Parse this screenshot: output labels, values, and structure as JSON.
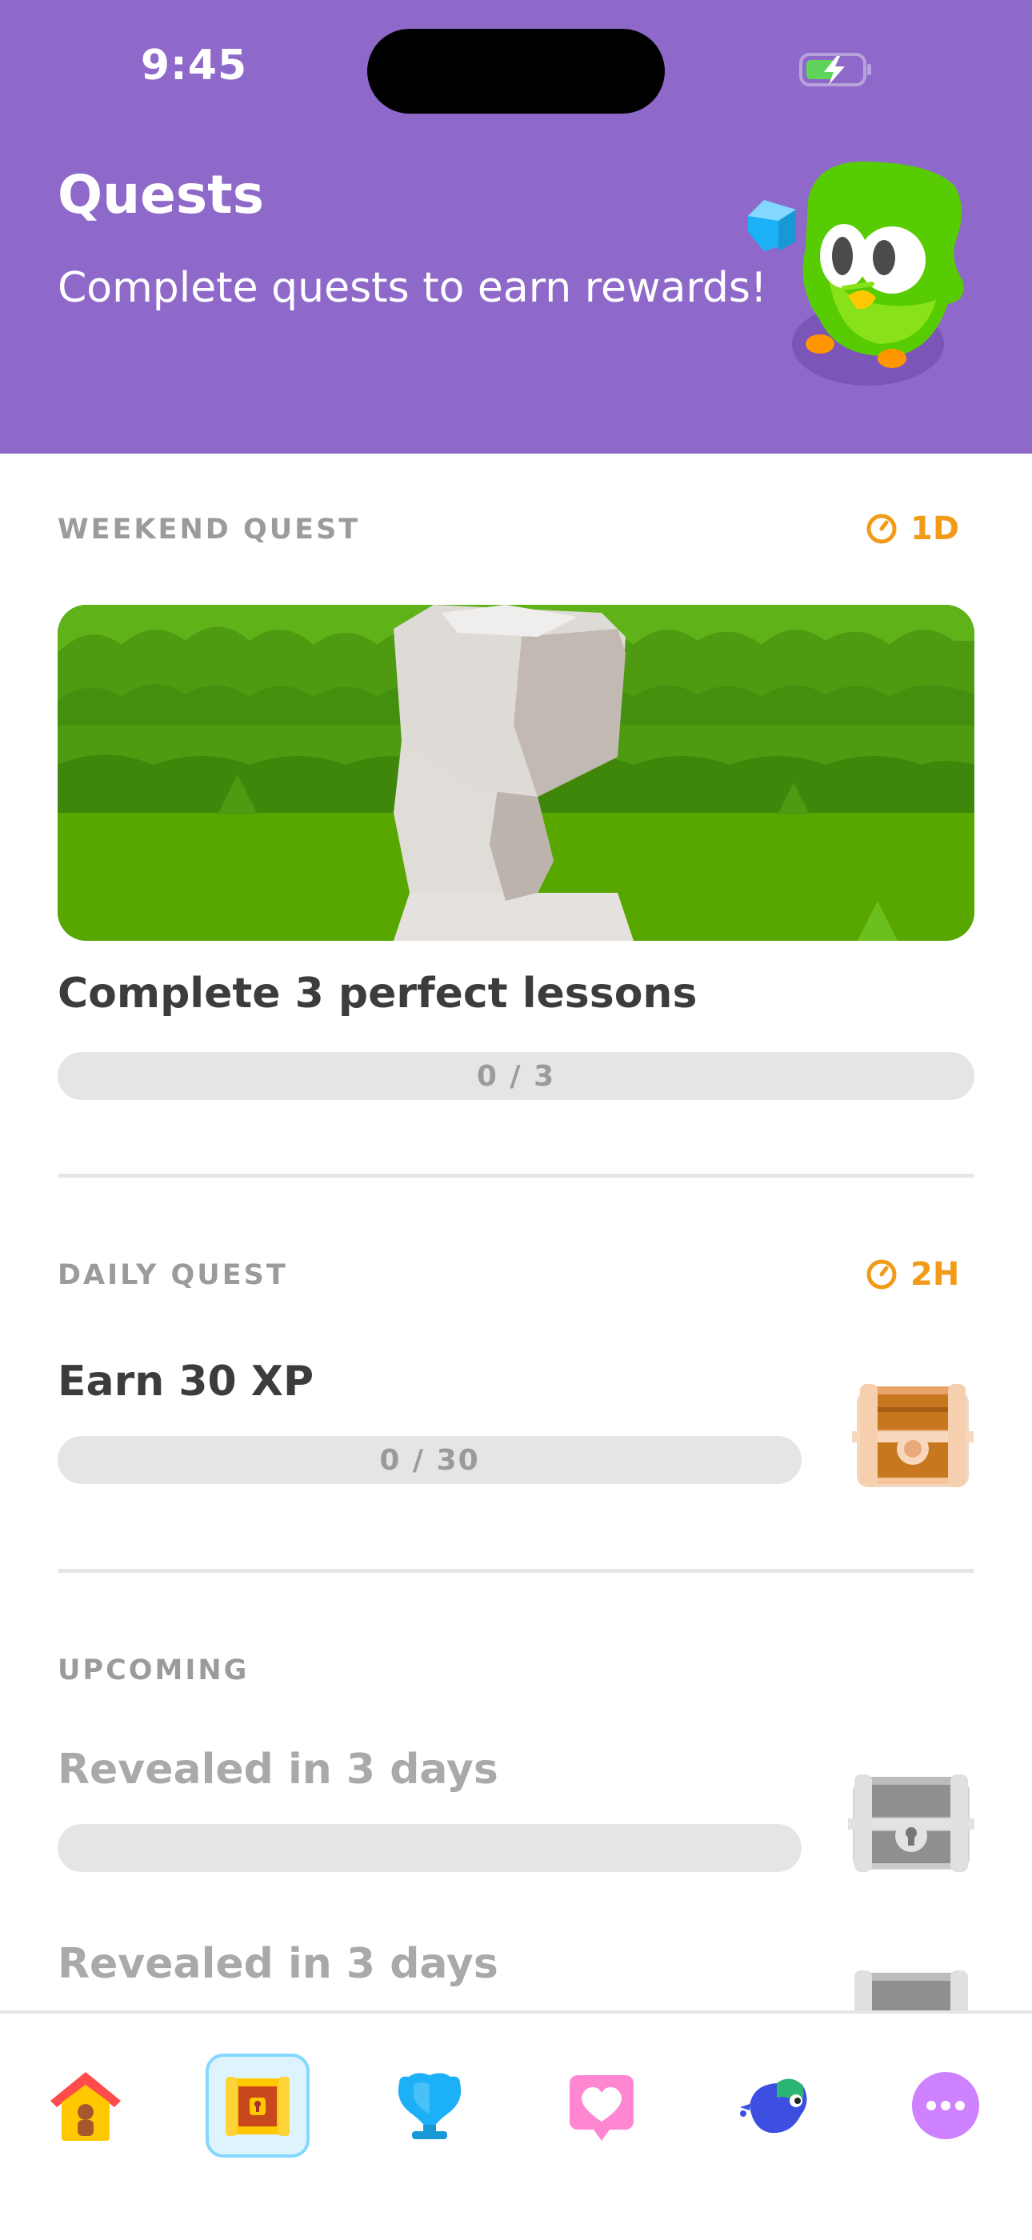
{
  "status_bar": {
    "time": "9:45"
  },
  "header": {
    "title": "Quests",
    "subtitle": "Complete quests to earn rewards!"
  },
  "weekend_quest": {
    "label": "WEEKEND QUEST",
    "timer": "1D",
    "title": "Complete 3 perfect lessons",
    "progress_text": "0 / 3",
    "progress_fraction": 0
  },
  "daily_quest": {
    "label": "DAILY QUEST",
    "timer": "2H",
    "title": "Earn 30 XP",
    "progress_text": "0 / 30",
    "progress_fraction": 0,
    "reward_icon": "chest-icon"
  },
  "upcoming": {
    "label": "UPCOMING",
    "items": [
      {
        "title": "Revealed in 3 days",
        "reward_icon": "locked-chest-icon"
      },
      {
        "title": "Revealed in 3 days",
        "reward_icon": "locked-chest-icon"
      }
    ]
  },
  "nav": {
    "items": [
      {
        "icon": "home-icon",
        "active": false
      },
      {
        "icon": "quests-chest-icon",
        "active": true
      },
      {
        "icon": "leagues-trophy-icon",
        "active": false
      },
      {
        "icon": "hearts-icon",
        "active": false
      },
      {
        "icon": "characters-bird-icon",
        "active": false
      },
      {
        "icon": "more-icon",
        "active": false
      }
    ]
  },
  "colors": {
    "header_bg": "#8e69ca",
    "timer": "#f19b18",
    "progress_track": "#e5e5e5",
    "active_nav_bg": "#ddf4ff",
    "active_nav_border": "#84d8ff"
  }
}
